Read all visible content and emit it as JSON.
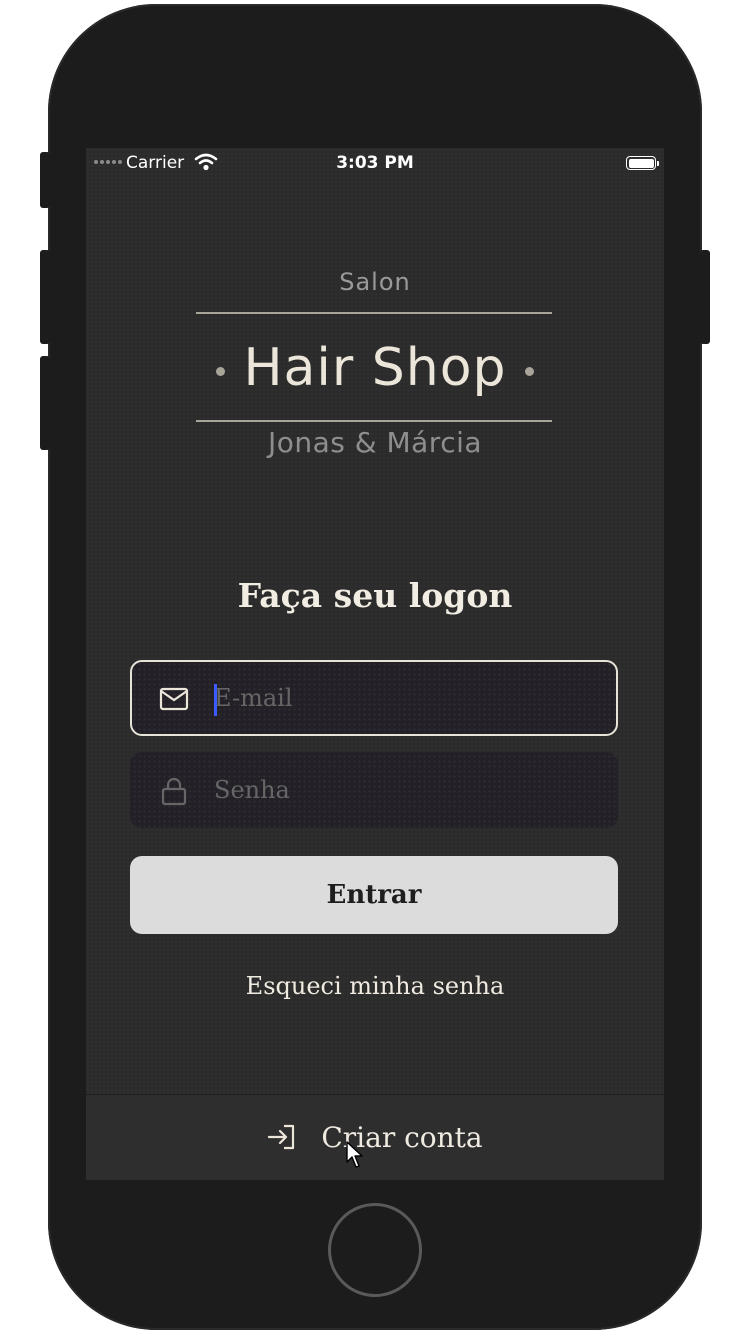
{
  "status_bar": {
    "carrier": "Carrier",
    "time": "3:03 PM"
  },
  "logo": {
    "top": "Salon",
    "main": "Hair Shop",
    "sub": "Jonas & Márcia"
  },
  "form": {
    "title": "Faça seu logon",
    "email_placeholder": "E-mail",
    "email_value": "",
    "password_placeholder": "Senha",
    "password_value": "",
    "submit_label": "Entrar",
    "forgot_label": "Esqueci minha senha"
  },
  "footer": {
    "create_account_label": "Criar conta"
  },
  "icons": {
    "email": "mail-icon",
    "password": "lock-icon",
    "create_account": "log-in-icon"
  },
  "colors": {
    "background": "#2b2b2b",
    "text": "#f0ebe1",
    "button_bg": "#dcdcdc",
    "focus_border": "#e8e3d9",
    "caret": "#3b5bff"
  }
}
